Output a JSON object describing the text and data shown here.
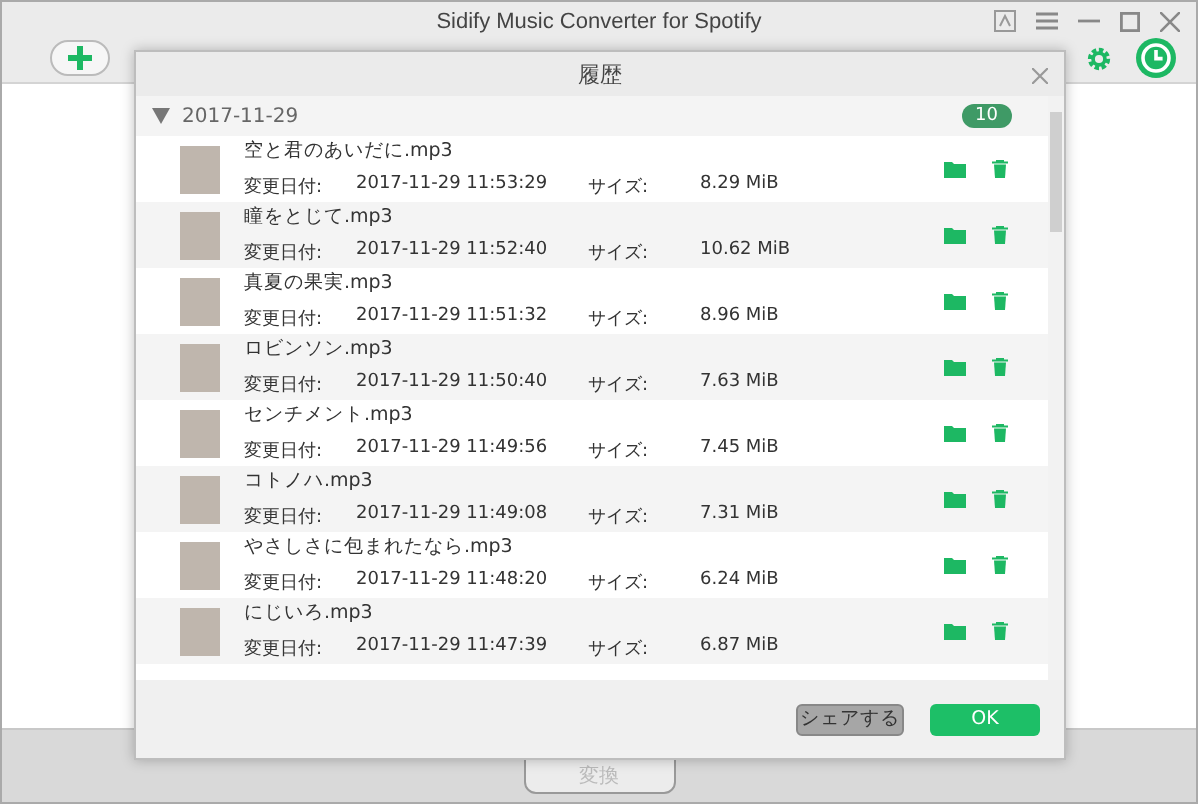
{
  "window": {
    "title": "Sidify Music Converter for Spotify"
  },
  "convert_button": "変換",
  "dialog": {
    "title": "履歴",
    "group": {
      "date": "2017-11-29",
      "count": "10",
      "expanded": true
    },
    "rows": [
      {
        "name": "空と君のあいだに.mp3",
        "date_label": "変更日付:",
        "date": "2017-11-29 11:53:29",
        "size_label": "サイズ:",
        "size": "8.29 MiB"
      },
      {
        "name": "瞳をとじて.mp3",
        "date_label": "変更日付:",
        "date": "2017-11-29 11:52:40",
        "size_label": "サイズ:",
        "size": "10.62 MiB"
      },
      {
        "name": "真夏の果実.mp3",
        "date_label": "変更日付:",
        "date": "2017-11-29 11:51:32",
        "size_label": "サイズ:",
        "size": "8.96 MiB"
      },
      {
        "name": "ロビンソン.mp3",
        "date_label": "変更日付:",
        "date": "2017-11-29 11:50:40",
        "size_label": "サイズ:",
        "size": "7.63 MiB"
      },
      {
        "name": "センチメント.mp3",
        "date_label": "変更日付:",
        "date": "2017-11-29 11:49:56",
        "size_label": "サイズ:",
        "size": "7.45 MiB"
      },
      {
        "name": "コトノハ.mp3",
        "date_label": "変更日付:",
        "date": "2017-11-29 11:49:08",
        "size_label": "サイズ:",
        "size": "7.31 MiB"
      },
      {
        "name": "やさしさに包まれたなら.mp3",
        "date_label": "変更日付:",
        "date": "2017-11-29 11:48:20",
        "size_label": "サイズ:",
        "size": "6.24 MiB"
      },
      {
        "name": "にじいろ.mp3",
        "date_label": "変更日付:",
        "date": "2017-11-29 11:47:39",
        "size_label": "サイズ:",
        "size": "6.87 MiB"
      }
    ],
    "buttons": [
      {
        "label": "シェアする",
        "kind": "secondary"
      },
      {
        "label": "OK",
        "kind": "primary"
      }
    ]
  }
}
